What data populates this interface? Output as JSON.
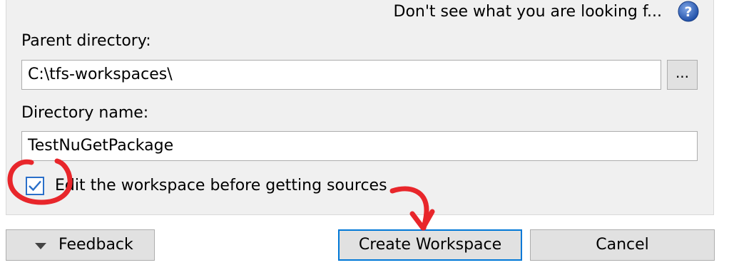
{
  "help": {
    "link_text": "Don't see what you are looking f...",
    "icon": "question-circle-icon"
  },
  "form": {
    "parent_directory_label": "Parent directory:",
    "parent_directory_value": "C:\\tfs-workspaces\\",
    "browse_label": "...",
    "directory_name_label": "Directory name:",
    "directory_name_value": "TestNuGetPackage",
    "edit_workspace_checkbox": {
      "label": "Edit the workspace before getting sources",
      "checked": true
    }
  },
  "footer": {
    "feedback_label": "Feedback",
    "feedback_icon": "triangle-down-icon",
    "create_label": "Create Workspace",
    "cancel_label": "Cancel"
  },
  "colors": {
    "accent": "#0078d7",
    "annotation": "#e8262b",
    "panel_bg": "#f0f0f0"
  }
}
